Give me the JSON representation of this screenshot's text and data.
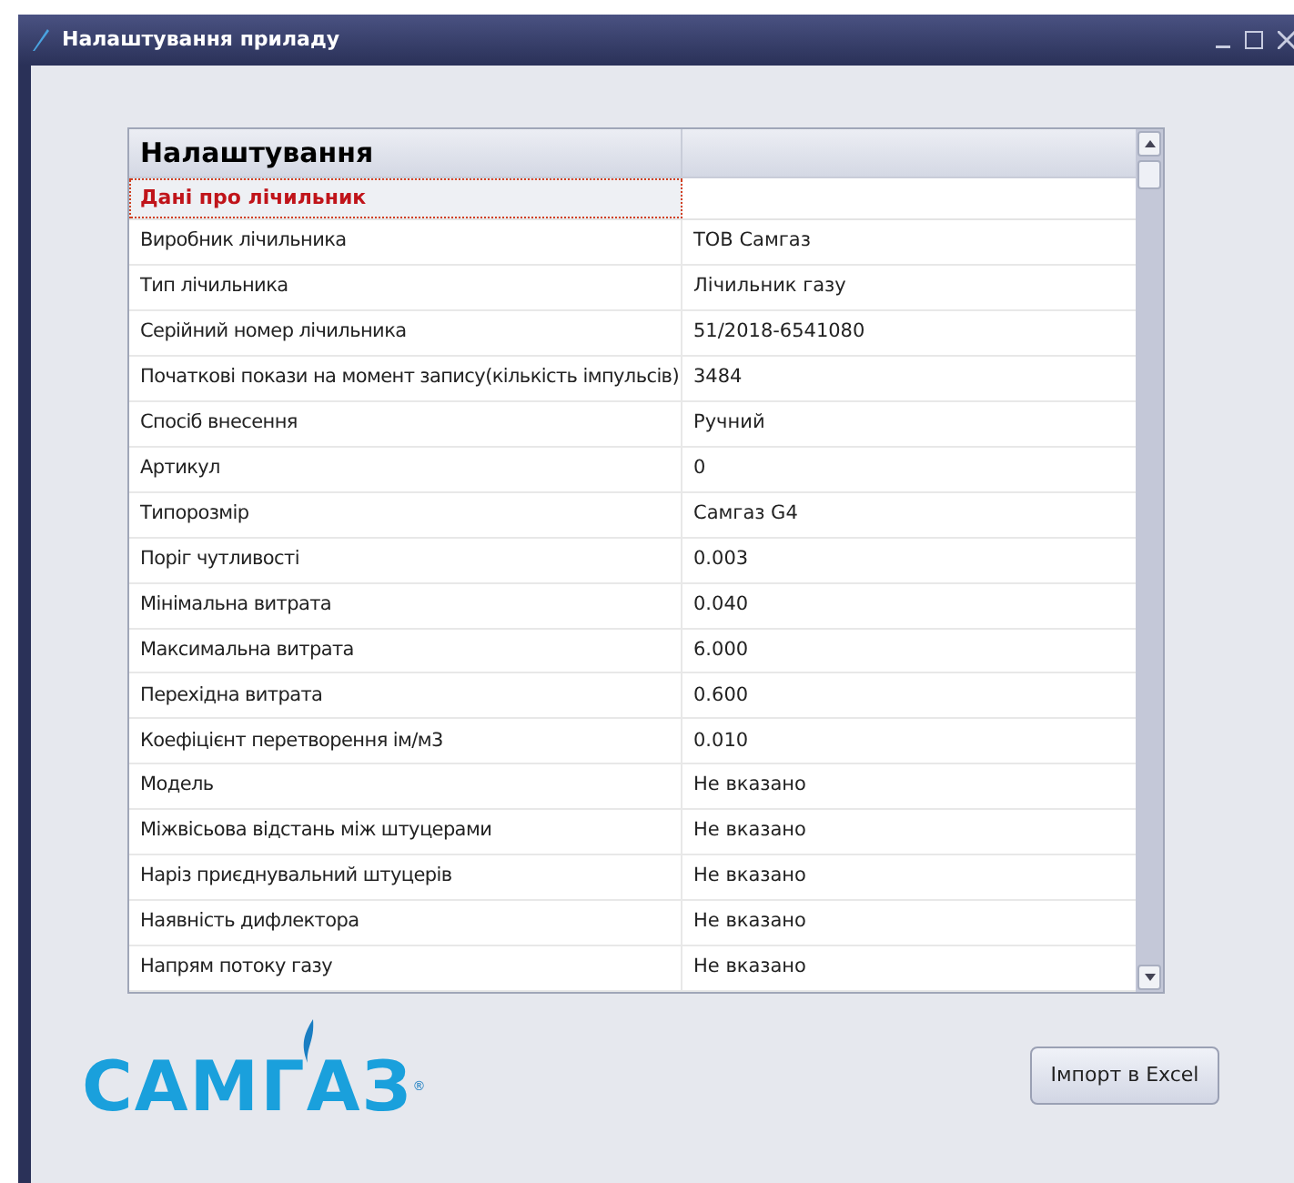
{
  "window": {
    "title": "Налаштування приладу"
  },
  "table": {
    "columns": [
      "Налаштування",
      ""
    ],
    "category": {
      "label": "Дані про лічильник",
      "selected": true
    },
    "rows": [
      {
        "name": "Виробник лічильника",
        "value": "ТОВ Самгаз"
      },
      {
        "name": "Тип лічильника",
        "value": "Лічильник газу"
      },
      {
        "name": "Серійний номер лічильника",
        "value": "51/2018-6541080"
      },
      {
        "name": "Початкові покази на момент запису(кількість імпульсів)",
        "value": "3484"
      },
      {
        "name": "Спосіб внесення",
        "value": "Ручний"
      },
      {
        "name": "Артикул",
        "value": "0"
      },
      {
        "name": "Типорозмір",
        "value": "Самгаз G4"
      },
      {
        "name": "Поріг чутливості",
        "value": "0.003"
      },
      {
        "name": "Мінімальна витрата",
        "value": "0.040"
      },
      {
        "name": "Максимальна витрата",
        "value": "6.000"
      },
      {
        "name": "Перехідна витрата",
        "value": "0.600"
      },
      {
        "name": "Коефіцієнт перетворення ім/м3",
        "value": "0.010"
      },
      {
        "name": "Модель",
        "value": "Не вказано"
      },
      {
        "name": "Міжвісьова відстань між штуцерами",
        "value": "Не вказано"
      },
      {
        "name": "Наріз приєднувальний штуцерів",
        "value": "Не вказано"
      },
      {
        "name": "Наявність дифлектора",
        "value": "Не вказано"
      },
      {
        "name": "Напрям потоку газу",
        "value": "Не вказано"
      }
    ]
  },
  "logo": {
    "text": "САМГАЗ",
    "mark": "®"
  },
  "buttons": [
    "Імпорт в Excel"
  ]
}
